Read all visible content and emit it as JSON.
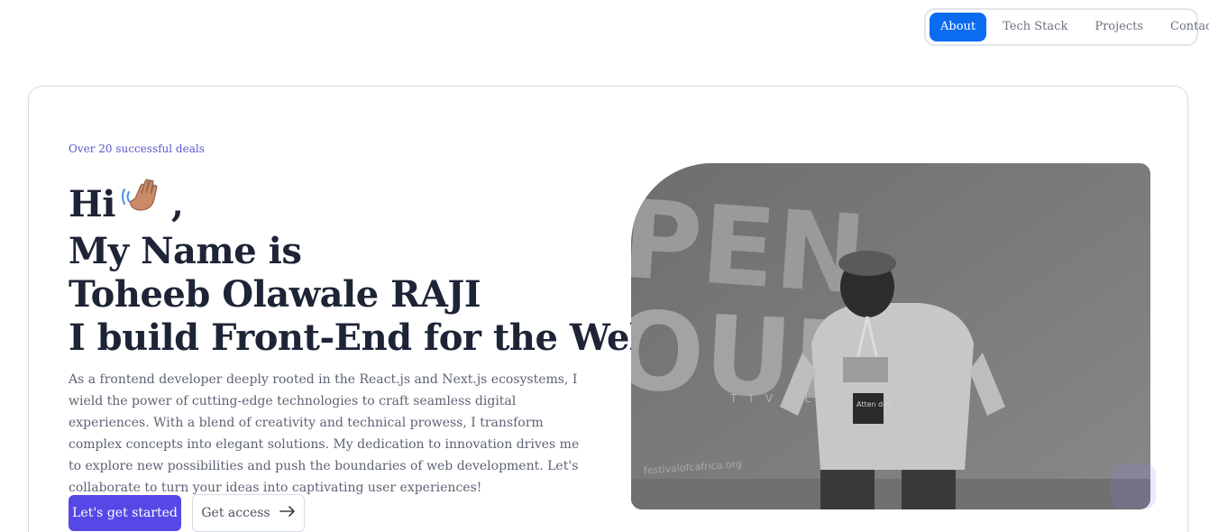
{
  "nav": {
    "items": [
      {
        "label": "About",
        "active": true
      },
      {
        "label": "Tech Stack",
        "active": false
      },
      {
        "label": "Projects",
        "active": false
      },
      {
        "label": "Contact",
        "active": false
      }
    ]
  },
  "hero": {
    "eyebrow": "Over 20 successful deals",
    "greeting": "Hi",
    "greeting_suffix": ",",
    "wave_icon": "waving-hand-icon",
    "line2": "My Name is",
    "line3": "Toheeb Olawale RAJI",
    "line4": "I build Front-End for the Web",
    "bio": "As a frontend developer deeply rooted in the React.js and Next.js ecosystems, I wield the power of cutting-edge technologies to craft seamless digital experiences. With a blend of creativity and technical prowess, I transform complex concepts into elegant solutions. My dedication to innovation drives me to explore new possibilities and push the boundaries of web development. Let's collaborate to turn your ideas into captivating user experiences!",
    "primary_button": "Let's get started",
    "secondary_button": "Get access",
    "secondary_icon": "arrow-right-icon"
  },
  "photo": {
    "banner_text": "festivalofcafrica.org",
    "badge_text": "Atten dee"
  },
  "colors": {
    "accent": "#5648e6",
    "nav_active": "#0b6cf0",
    "eyebrow": "#5b57c9"
  }
}
